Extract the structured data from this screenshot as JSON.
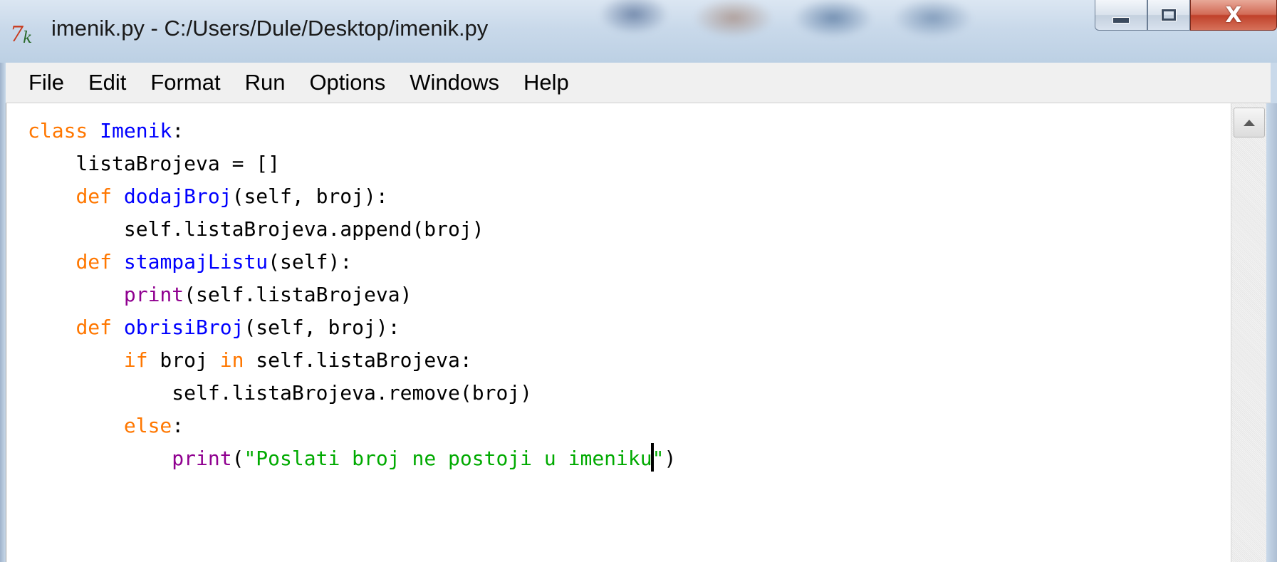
{
  "window": {
    "title": "imenik.py - C:/Users/Dule/Desktop/imenik.py",
    "app_icon": "idle-python-icon",
    "controls": {
      "minimize_icon": "minimize-icon",
      "maximize_icon": "maximize-icon",
      "close_glyph": "X"
    }
  },
  "menu": {
    "items": [
      "File",
      "Edit",
      "Format",
      "Run",
      "Options",
      "Windows",
      "Help"
    ]
  },
  "editor": {
    "colors": {
      "keyword": "#ff7700",
      "definition": "#0000ff",
      "builtin": "#900090",
      "string": "#00aa00",
      "text": "#000000"
    },
    "lines": [
      [
        {
          "t": "kw",
          "v": "class"
        },
        {
          "t": "plain",
          "v": " "
        },
        {
          "t": "def",
          "v": "Imenik"
        },
        {
          "t": "plain",
          "v": ":"
        }
      ],
      [
        {
          "t": "plain",
          "v": "    listaBrojeva = []"
        }
      ],
      [
        {
          "t": "plain",
          "v": "    "
        },
        {
          "t": "kw",
          "v": "def"
        },
        {
          "t": "plain",
          "v": " "
        },
        {
          "t": "def",
          "v": "dodajBroj"
        },
        {
          "t": "plain",
          "v": "(self, broj):"
        }
      ],
      [
        {
          "t": "plain",
          "v": "        self.listaBrojeva.append(broj)"
        }
      ],
      [
        {
          "t": "plain",
          "v": "    "
        },
        {
          "t": "kw",
          "v": "def"
        },
        {
          "t": "plain",
          "v": " "
        },
        {
          "t": "def",
          "v": "stampajListu"
        },
        {
          "t": "plain",
          "v": "(self):"
        }
      ],
      [
        {
          "t": "plain",
          "v": "        "
        },
        {
          "t": "builtin",
          "v": "print"
        },
        {
          "t": "plain",
          "v": "(self.listaBrojeva)"
        }
      ],
      [
        {
          "t": "plain",
          "v": "    "
        },
        {
          "t": "kw",
          "v": "def"
        },
        {
          "t": "plain",
          "v": " "
        },
        {
          "t": "def",
          "v": "obrisiBroj"
        },
        {
          "t": "plain",
          "v": "(self, broj):"
        }
      ],
      [
        {
          "t": "plain",
          "v": "        "
        },
        {
          "t": "kw",
          "v": "if"
        },
        {
          "t": "plain",
          "v": " broj "
        },
        {
          "t": "kw",
          "v": "in"
        },
        {
          "t": "plain",
          "v": " self.listaBrojeva:"
        }
      ],
      [
        {
          "t": "plain",
          "v": "            self.listaBrojeva.remove(broj)"
        }
      ],
      [
        {
          "t": "plain",
          "v": "        "
        },
        {
          "t": "kw",
          "v": "else"
        },
        {
          "t": "plain",
          "v": ":"
        }
      ],
      [
        {
          "t": "plain",
          "v": "            "
        },
        {
          "t": "builtin",
          "v": "print"
        },
        {
          "t": "plain",
          "v": "("
        },
        {
          "t": "str",
          "v": "\"Poslati broj ne postoji u imeniku"
        },
        {
          "t": "cursor",
          "v": ""
        },
        {
          "t": "str",
          "v": "\""
        },
        {
          "t": "plain",
          "v": ")"
        }
      ]
    ]
  },
  "scrollbar": {
    "up_icon": "scroll-up-arrow-icon"
  }
}
